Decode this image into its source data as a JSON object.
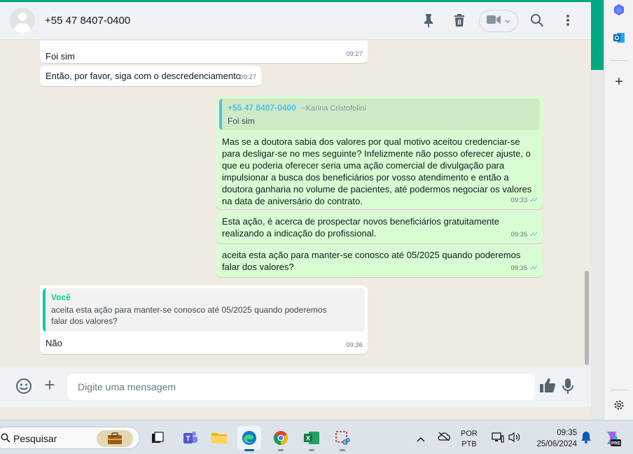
{
  "header": {
    "contact_name": "+55 47 8407-0400"
  },
  "messages": [
    {
      "dir": "in",
      "text": "Foi sim",
      "time": "09:27"
    },
    {
      "dir": "in",
      "text": "Então, por favor, siga com o descredenciamento",
      "time": "09:27"
    },
    {
      "dir": "out",
      "quote_author": "+55 47 8407-0400",
      "quote_author_alias": "~Karina Cristofolini",
      "quote_text": "Foi sim",
      "text": "Mas se a doutora sabia dos valores por qual motivo aceitou credenciar-se para desligar-se no mes seguinte? Infelizmente não posso oferecer ajuste, o que eu poderia oferecer seria uma ação comercial de divulgação para impulsionar a busca dos beneficiários por vosso atendimento e então a doutora ganharia no volume de pacientes, até podermos negociar os valores na data de aniversário do contrato.",
      "time": "09:33"
    },
    {
      "dir": "out",
      "text": "Esta ação, é acerca de prospectar novos beneficiários gratuitamente realizando a indicação do profissional.",
      "time": "09:35"
    },
    {
      "dir": "out",
      "text": "aceita esta ação para manter-se conosco até 05/2025 quando poderemos falar dos valores?",
      "time": "09:35"
    },
    {
      "dir": "in",
      "quote_author": "Você",
      "quote_text": "aceita esta ação para manter-se conosco até 05/2025 quando poderemos falar dos valores?",
      "text": "Não",
      "time": "09:36"
    }
  ],
  "composer": {
    "placeholder": "Digite uma mensagem"
  },
  "taskbar": {
    "search_label": "Pesquisar",
    "lang_line1": "POR",
    "lang_line2": "PTB",
    "time": "09:35",
    "date": "25/06/2024"
  },
  "colors": {
    "accent": "#00a884",
    "outgoing_bubble": "#d9fdd3",
    "incoming_bubble": "#ffffff",
    "chat_background": "#efeae2",
    "read_ticks": "#53bdeb"
  }
}
